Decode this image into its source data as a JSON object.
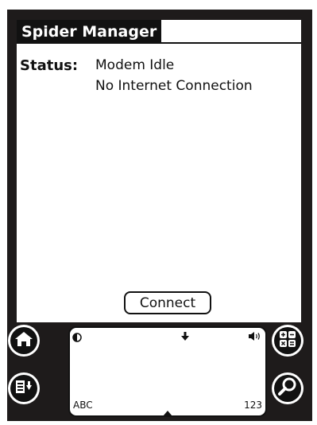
{
  "app": {
    "title": "Spider Manager"
  },
  "status": {
    "label": "Status:",
    "line1": "Modem Idle",
    "line2": "No Internet Connection"
  },
  "actions": {
    "connect_label": "Connect"
  },
  "graffiti": {
    "left_label": "ABC",
    "right_label": "123"
  },
  "icons": {
    "home": "home-icon",
    "menu": "menu-icon",
    "calculator": "calculator-icon",
    "find": "find-icon",
    "brightness": "brightness-icon",
    "menu_arrow": "down-arrow-icon",
    "volume": "volume-icon"
  },
  "colors": {
    "device_body": "#1e1b1b",
    "screen": "#ffffff",
    "text": "#111111"
  }
}
